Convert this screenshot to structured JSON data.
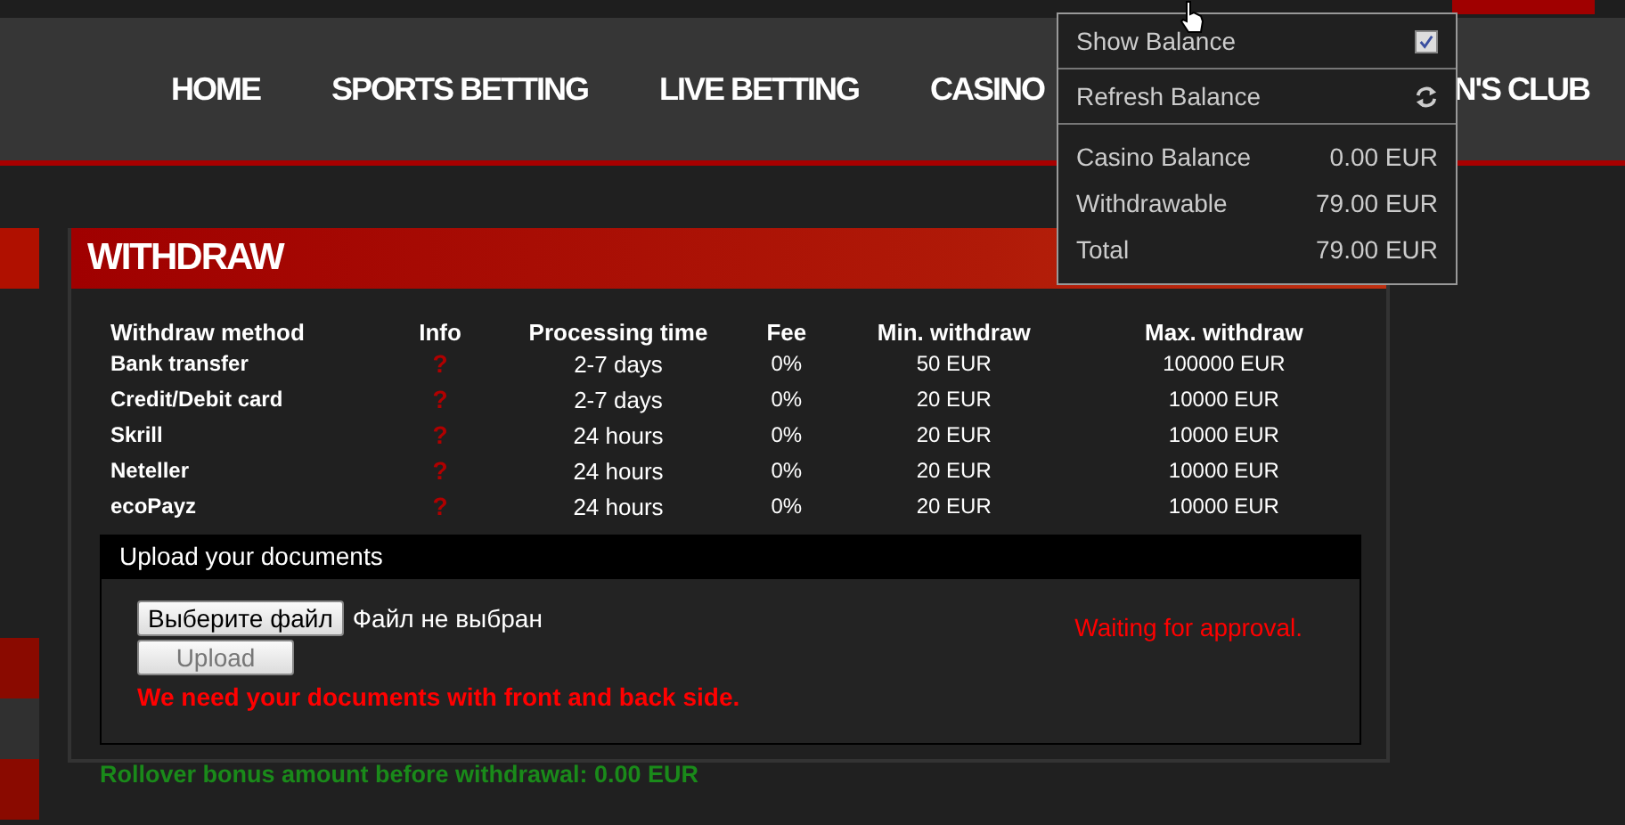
{
  "nav": {
    "items": [
      "HOME",
      "SPORTS BETTING",
      "LIVE BETTING",
      "CASINO",
      "N'S CLUB"
    ]
  },
  "balance_menu": {
    "show_balance": {
      "label": "Show Balance",
      "checked": true
    },
    "refresh": {
      "label": "Refresh Balance"
    },
    "rows": [
      {
        "label": "Casino Balance",
        "value": "0.00 EUR"
      },
      {
        "label": "Withdrawable",
        "value": "79.00 EUR"
      },
      {
        "label": "Total",
        "value": "79.00 EUR"
      }
    ]
  },
  "withdraw": {
    "title": "WITHDRAW",
    "table": {
      "columns": [
        "Withdraw method",
        "Info",
        "Processing time",
        "Fee",
        "Min. withdraw",
        "Max. withdraw"
      ],
      "rows": [
        {
          "method": "Bank transfer",
          "info": "?",
          "time": "2-7 days",
          "fee": "0%",
          "min": "50 EUR",
          "max": "100000 EUR"
        },
        {
          "method": "Credit/Debit card",
          "info": "?",
          "time": "2-7 days",
          "fee": "0%",
          "min": "20 EUR",
          "max": "10000 EUR"
        },
        {
          "method": "Skrill",
          "info": "?",
          "time": "24 hours",
          "fee": "0%",
          "min": "20 EUR",
          "max": "10000 EUR"
        },
        {
          "method": "Neteller",
          "info": "?",
          "time": "24 hours",
          "fee": "0%",
          "min": "20 EUR",
          "max": "10000 EUR"
        },
        {
          "method": "ecoPayz",
          "info": "?",
          "time": "24 hours",
          "fee": "0%",
          "min": "20 EUR",
          "max": "10000 EUR"
        }
      ]
    },
    "upload": {
      "title": "Upload your documents",
      "choose_button": "Выберите файл",
      "file_status": "Файл не выбран",
      "upload_button": "Upload",
      "upload_disabled": true,
      "warning": "We need your documents with front and back side.",
      "status": "Waiting for approval."
    },
    "rollover": "Rollover bonus amount before withdrawal: 0.00 EUR"
  }
}
